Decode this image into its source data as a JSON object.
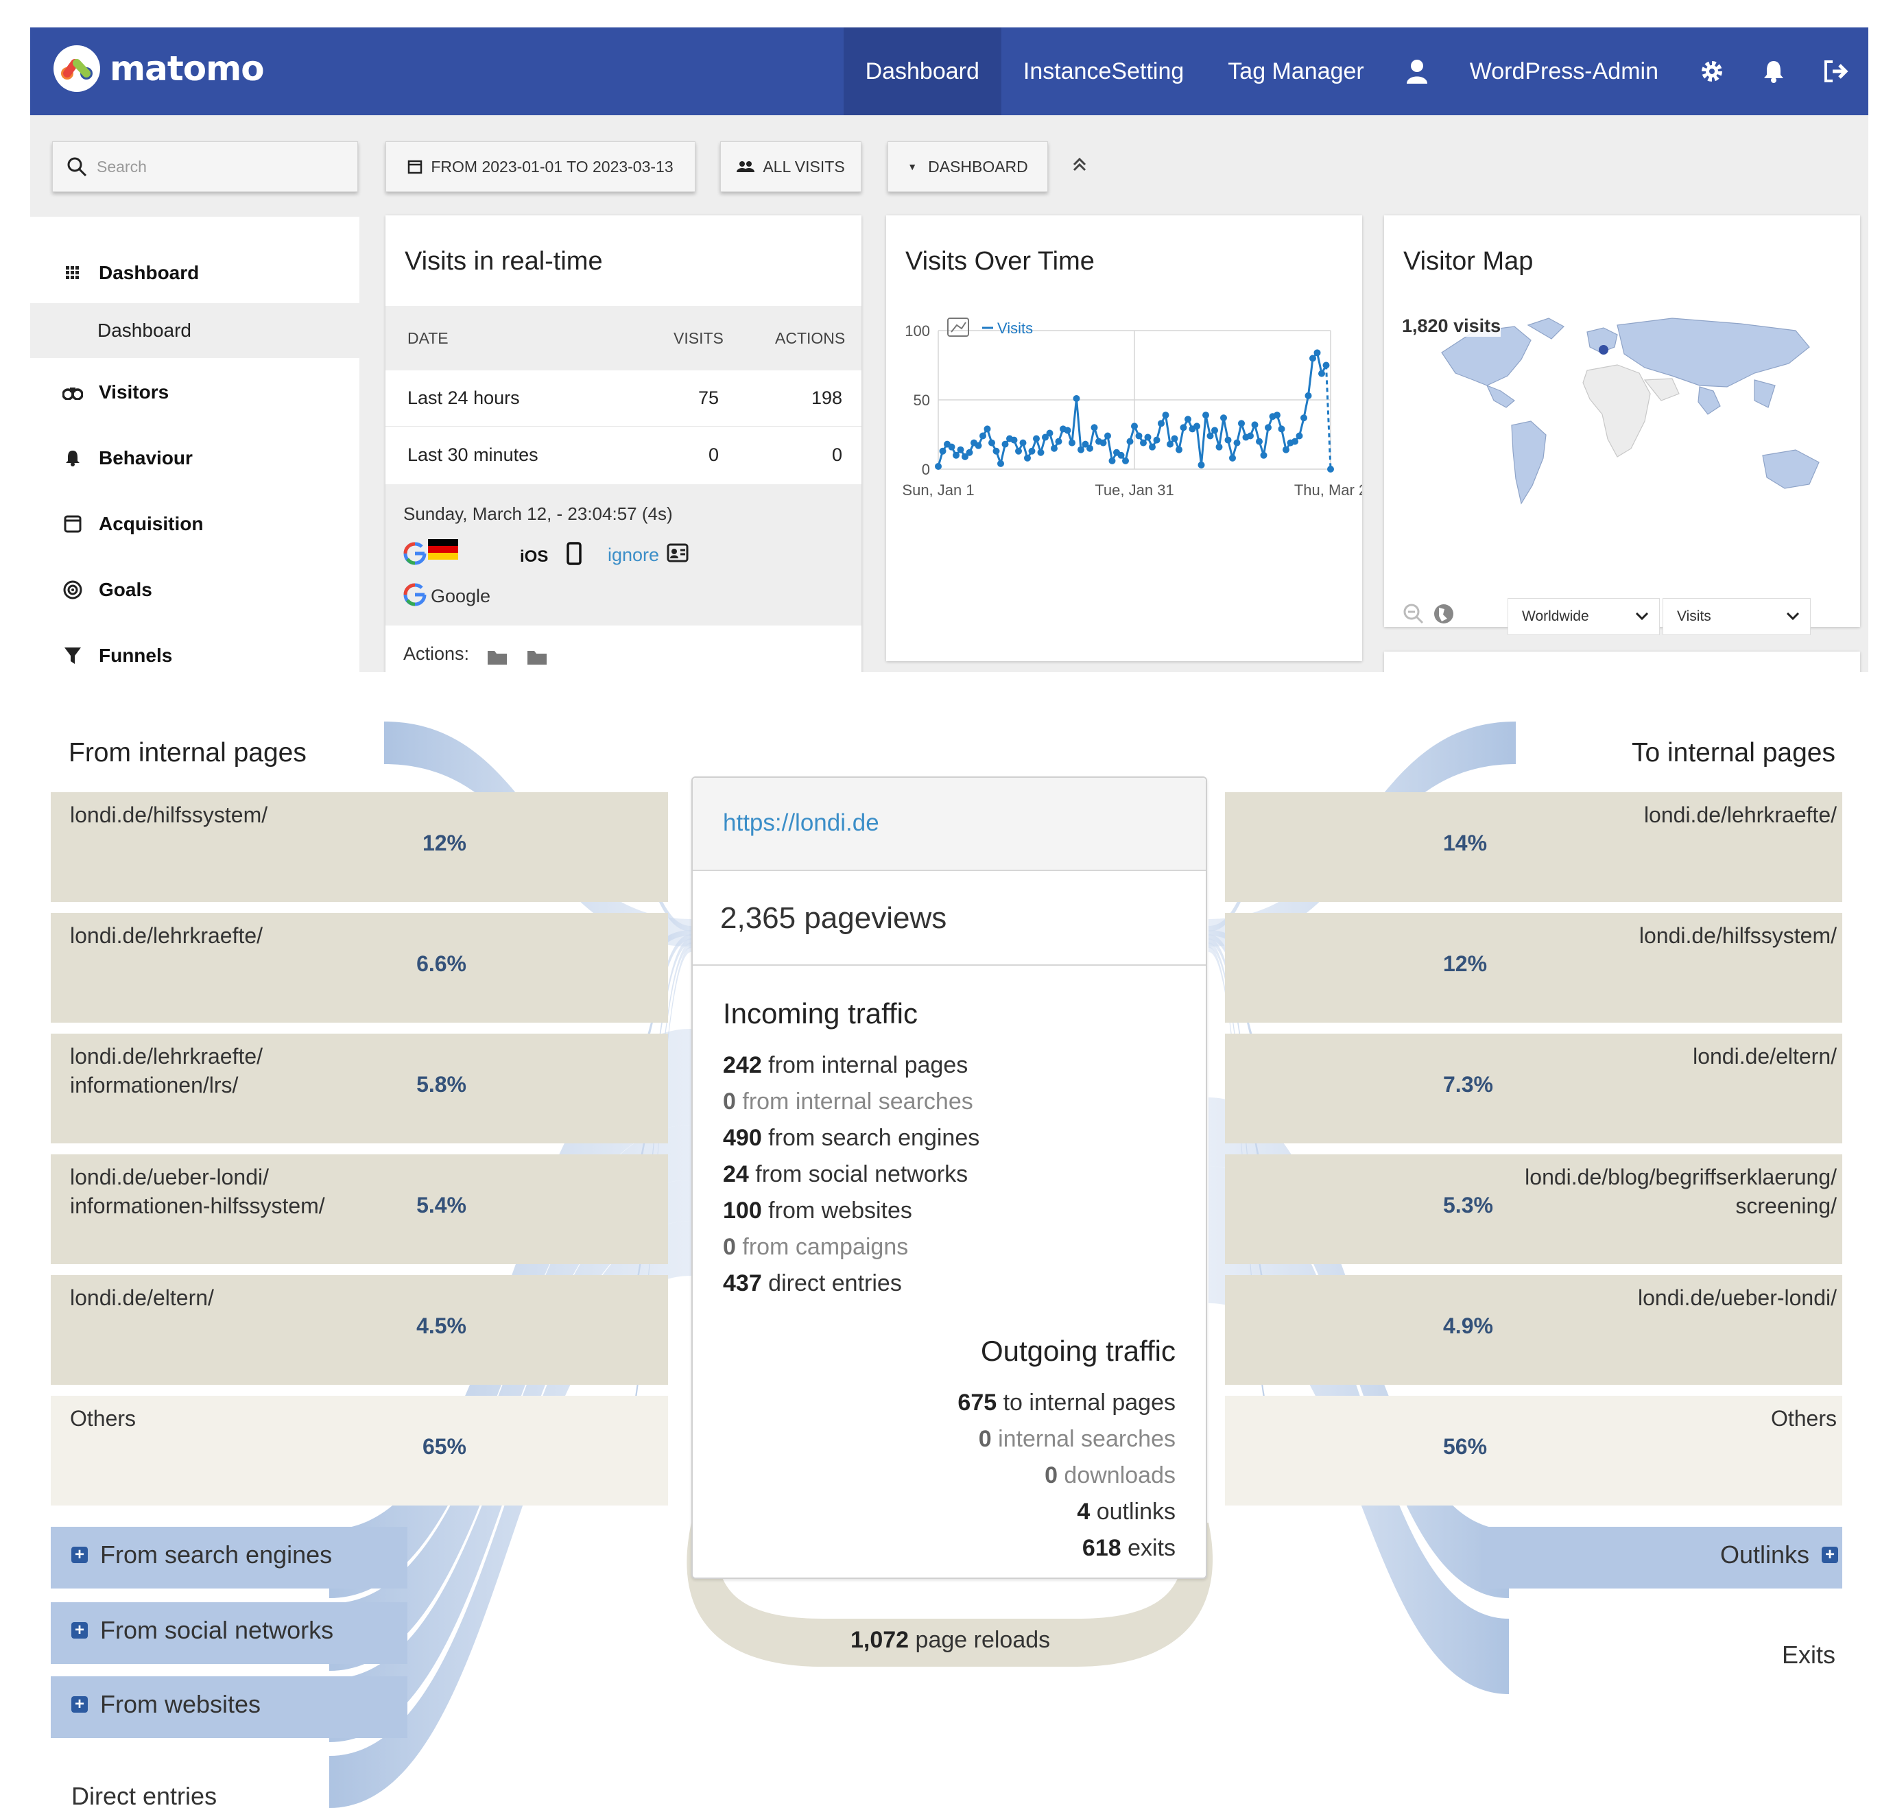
{
  "app": {
    "brand": "matomo"
  },
  "nav": {
    "items": [
      "Dashboard",
      "InstanceSetting",
      "Tag Manager",
      "WordPress-Admin"
    ],
    "icons": [
      "user-icon",
      "gear-icon",
      "bell-icon",
      "logout-icon"
    ],
    "bg_color": "#3450a3",
    "active_color": "#2c448f"
  },
  "toolbar": {
    "search_placeholder": "Search",
    "date_range": "FROM 2023-01-01 TO 2023-03-13",
    "segment": "ALL VISITS",
    "dashboard": "DASHBOARD"
  },
  "sidebar": {
    "items": [
      {
        "label": "Dashboard",
        "icon": "grid-icon"
      },
      {
        "label": "Visitors",
        "icon": "binoculars-icon"
      },
      {
        "label": "Behaviour",
        "icon": "bell-icon"
      },
      {
        "label": "Acquisition",
        "icon": "window-icon"
      },
      {
        "label": "Goals",
        "icon": "target-icon"
      },
      {
        "label": "Funnels",
        "icon": "funnel-icon"
      }
    ],
    "sub_item": "Dashboard"
  },
  "realtime": {
    "title": "Visits in real-time",
    "headers": [
      "DATE",
      "VISITS",
      "ACTIONS"
    ],
    "rows": [
      {
        "date": "Last 24 hours",
        "visits": "75",
        "actions": "198"
      },
      {
        "date": "Last 30 minutes",
        "visits": "0",
        "actions": "0"
      }
    ],
    "visit_time": "Sunday, March 12, - 23:04:57 (4s)",
    "os": "iOS",
    "ignore": "ignore",
    "referrer": "Google",
    "actions_label": "Actions:"
  },
  "visits_over_time": {
    "title": "Visits Over Time",
    "legend": "Visits",
    "series_color": "#1f7ac4"
  },
  "chart_data": {
    "type": "line",
    "title": "Visits Over Time",
    "xlabel": "",
    "ylabel": "",
    "x_ticks": [
      "Sun, Jan 1",
      "Tue, Jan 31",
      "Thu, Mar 2"
    ],
    "y_ticks": [
      "0",
      "50",
      "100"
    ],
    "ylim": [
      0,
      100
    ],
    "grid": true,
    "legend_position": "top-left",
    "series": [
      {
        "name": "Visits",
        "values": [
          2,
          13,
          18,
          16,
          10,
          14,
          9,
          12,
          19,
          17,
          24,
          29,
          19,
          13,
          4,
          18,
          22,
          21,
          13,
          19,
          8,
          13,
          22,
          12,
          23,
          26,
          15,
          20,
          29,
          28,
          19,
          51,
          14,
          18,
          15,
          30,
          20,
          19,
          24,
          6,
          12,
          10,
          6,
          20,
          31,
          24,
          19,
          23,
          16,
          21,
          33,
          39,
          18,
          22,
          14,
          30,
          36,
          29,
          31,
          3,
          39,
          24,
          28,
          16,
          37,
          21,
          8,
          19,
          33,
          23,
          24,
          32,
          20,
          10,
          30,
          38,
          39,
          29,
          14,
          19,
          20,
          24,
          37,
          53,
          80,
          84,
          69,
          75,
          0
        ]
      }
    ]
  },
  "visitor_map": {
    "title": "Visitor Map",
    "visits_label": "1,820 visits",
    "region": "Worldwide",
    "metric": "Visits"
  },
  "transitions": {
    "url": "https://londi.de",
    "pageviews": "2,365 pageviews",
    "from_title": "From internal pages",
    "to_title": "To internal pages",
    "from_pages": [
      {
        "lines": [
          "londi.de/hilfssystem/"
        ],
        "pct": "12%"
      },
      {
        "lines": [
          "londi.de/lehrkraefte/"
        ],
        "pct": "6.6%"
      },
      {
        "lines": [
          "londi.de/lehrkraefte/",
          "informationen/lrs/"
        ],
        "pct": "5.8%"
      },
      {
        "lines": [
          "londi.de/ueber-londi/",
          "informationen-hilfssystem/"
        ],
        "pct": "5.4%"
      },
      {
        "lines": [
          "londi.de/eltern/"
        ],
        "pct": "4.5%"
      },
      {
        "lines": [
          "Others"
        ],
        "pct": "65%"
      }
    ],
    "to_pages": [
      {
        "lines": [
          "londi.de/lehrkraefte/"
        ],
        "pct": "14%"
      },
      {
        "lines": [
          "londi.de/hilfssystem/"
        ],
        "pct": "12%"
      },
      {
        "lines": [
          "londi.de/eltern/"
        ],
        "pct": "7.3%"
      },
      {
        "lines": [
          "londi.de/blog/begriffserklaerung/",
          "screening/"
        ],
        "pct": "5.3%"
      },
      {
        "lines": [
          "londi.de/ueber-londi/"
        ],
        "pct": "4.9%"
      },
      {
        "lines": [
          "Others"
        ],
        "pct": "56%"
      }
    ],
    "from_groups": [
      "From search engines",
      "From social networks",
      "From websites"
    ],
    "direct_entries": "Direct entries",
    "outlinks": "Outlinks",
    "exits": "Exits",
    "incoming_title": "Incoming traffic",
    "incoming": [
      {
        "num": "242",
        "text": " from internal pages",
        "dim": false
      },
      {
        "num": "0",
        "text": " from internal searches",
        "dim": true
      },
      {
        "num": "490",
        "text": " from search engines",
        "dim": false
      },
      {
        "num": "24",
        "text": " from social networks",
        "dim": false
      },
      {
        "num": "100",
        "text": " from websites",
        "dim": false
      },
      {
        "num": "0",
        "text": " from campaigns",
        "dim": true
      },
      {
        "num": "437",
        "text": " direct entries",
        "dim": false
      }
    ],
    "outgoing_title": "Outgoing traffic",
    "outgoing": [
      {
        "num": "675",
        "text": " to internal pages",
        "dim": false
      },
      {
        "num": "0",
        "text": " internal searches",
        "dim": true
      },
      {
        "num": "0",
        "text": " downloads",
        "dim": true
      },
      {
        "num": "4",
        "text": " outlinks",
        "dim": false
      },
      {
        "num": "618",
        "text": " exits",
        "dim": false
      }
    ],
    "reloads_num": "1,072",
    "reloads_text": " page reloads",
    "page_color": "#e2dfd2",
    "flow_color": "#a9c0e0"
  }
}
